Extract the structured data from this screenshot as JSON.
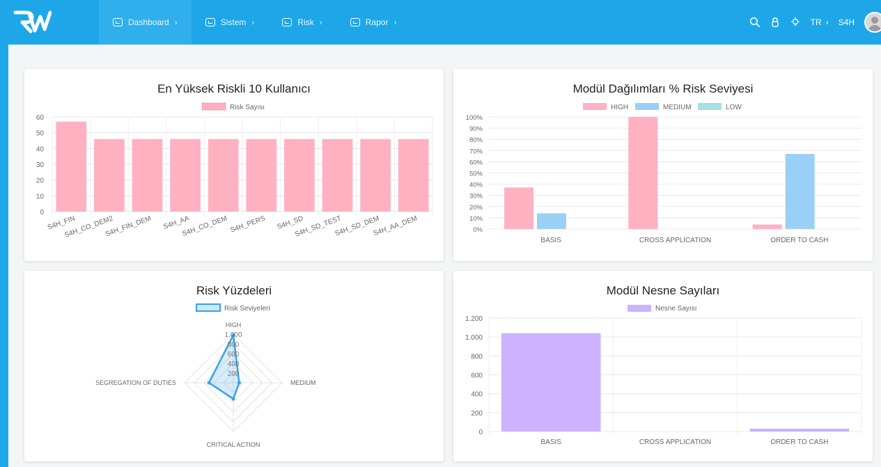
{
  "nav": {
    "items": [
      {
        "label": "Dashboard",
        "chevron": "›",
        "active": true
      },
      {
        "label": "Sistem",
        "chevron": "›"
      },
      {
        "label": "Risk",
        "chevron": "›"
      },
      {
        "label": "Rapor",
        "chevron": "›"
      }
    ],
    "language": "TR",
    "language_chevron": "›",
    "user": "S4H",
    "icons": [
      "search-icon",
      "lock-icon",
      "bulb-icon"
    ]
  },
  "colors": {
    "topbar": "#1ea7e8",
    "high": "#ffb1c1",
    "medium": "#9ad0f5",
    "low": "#a5dfdf",
    "purple": "#ccb2ff",
    "radar": "#36a2eb"
  },
  "cards": {
    "top_users": {
      "title": "En Yüksek Riskli 10 Kullanıcı",
      "chart_data": {
        "type": "bar",
        "title": "En Yüksek Riskli 10 Kullanıcı",
        "legend": "Risk Sayısı",
        "categories": [
          "S4H_FIN",
          "S4H_CO_DEM2",
          "S4H_FIN_DEM",
          "S4H_AA",
          "S4H_CO_DEM",
          "S4H_PERS",
          "S4H_SD",
          "S4H_SD_TEST",
          "S4H_SD_DEM",
          "S4H_AA_DEM"
        ],
        "series": [
          {
            "name": "Risk Sayısı",
            "values": [
              57,
              46,
              46,
              46,
              46,
              46,
              46,
              46,
              46,
              46
            ]
          }
        ],
        "ylim": [
          0,
          60
        ],
        "yticks": [
          "0",
          "10",
          "20",
          "30",
          "40",
          "50",
          "60"
        ]
      }
    },
    "module_risk": {
      "title": "Modül Dağılımları % Risk Seviyesi",
      "chart_data": {
        "type": "bar",
        "title": "Modül Dağılımları % Risk Seviyesi",
        "categories": [
          "BASIS",
          "CROSS APPLICATION",
          "ORDER TO CASH"
        ],
        "series": [
          {
            "name": "HIGH",
            "values": [
              37,
              100,
              4
            ]
          },
          {
            "name": "MEDIUM",
            "values": [
              14,
              0,
              67
            ]
          },
          {
            "name": "LOW",
            "values": [
              0,
              0,
              0
            ]
          }
        ],
        "ylim": [
          0,
          100
        ],
        "yticks": [
          "0%",
          "10%",
          "20%",
          "30%",
          "40%",
          "50%",
          "60%",
          "70%",
          "80%",
          "90%",
          "100%"
        ]
      }
    },
    "risk_percent": {
      "title": "Risk Yüzdeleri",
      "chart_data": {
        "type": "radar",
        "title": "Risk Yüzdeleri",
        "legend": "Risk Seviyeleri",
        "categories": [
          "HIGH",
          "MEDIUM",
          "CRITICAL ACTION",
          "SEGREGATION OF DUTIES"
        ],
        "series": [
          {
            "name": "Risk Seviyeleri",
            "values": [
              980,
              120,
              330,
              500
            ]
          }
        ],
        "ylim": [
          0,
          1000
        ],
        "ticks": [
          "200",
          "400",
          "600",
          "800",
          "1.000"
        ]
      }
    },
    "module_objects": {
      "title": "Modül Nesne Sayıları",
      "chart_data": {
        "type": "bar",
        "title": "Modül Nesne Sayıları",
        "legend": "Nesne Sayısı",
        "categories": [
          "BASIS",
          "CROSS APPLICATION",
          "ORDER TO CASH"
        ],
        "series": [
          {
            "name": "Nesne Sayısı",
            "values": [
              1040,
              0,
              30
            ]
          }
        ],
        "ylim": [
          0,
          1200
        ],
        "yticks": [
          "0",
          "200",
          "400",
          "600",
          "800",
          "1.000",
          "1.200"
        ]
      }
    }
  }
}
